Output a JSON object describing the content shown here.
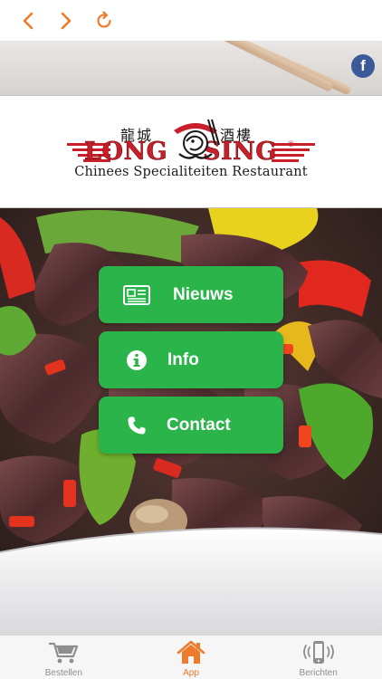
{
  "toolbar": {
    "back_icon": "chevron-left-icon",
    "forward_icon": "chevron-right-icon",
    "reload_icon": "reload-icon",
    "accent_color": "#ee7a2b"
  },
  "header": {
    "facebook_glyph": "f",
    "facebook_color": "#3b5998"
  },
  "logo": {
    "chinese_left": "龍城",
    "chinese_right": "酒樓",
    "word_left": "LONG",
    "word_right": "SING",
    "registered": "®",
    "tagline": "Chinees Specialiteiten Restaurant",
    "brand_color": "#c8202a"
  },
  "menu": {
    "button_color": "#2ab44a",
    "items": [
      {
        "label": "Nieuws",
        "icon": "newspaper-icon"
      },
      {
        "label": "Info",
        "icon": "info-icon"
      },
      {
        "label": "Contact",
        "icon": "phone-icon"
      }
    ]
  },
  "tabbar": {
    "active_color": "#ee7a2b",
    "inactive_color": "#8e8e8e",
    "tabs": [
      {
        "label": "Bestellen",
        "icon": "cart-icon",
        "active": false
      },
      {
        "label": "App",
        "icon": "home-icon",
        "active": true
      },
      {
        "label": "Berichten",
        "icon": "phone-vibrate-icon",
        "active": false
      }
    ]
  }
}
